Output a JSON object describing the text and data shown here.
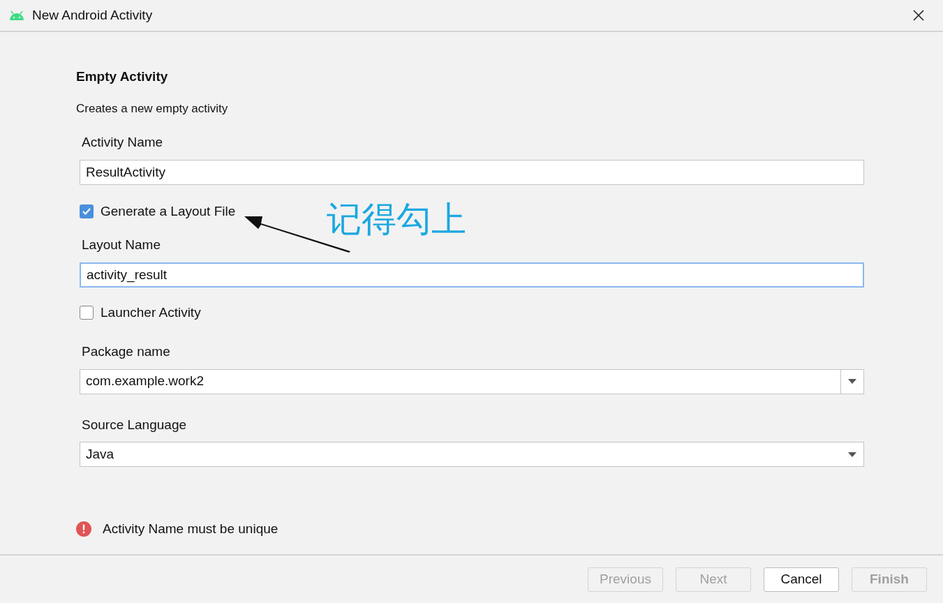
{
  "window": {
    "title": "New Android Activity"
  },
  "heading": "Empty Activity",
  "description": "Creates a new empty activity",
  "fields": [
    {
      "kind": "text",
      "label": "Activity Name",
      "value": "ResultActivity",
      "focused": false
    },
    {
      "kind": "checkbox",
      "label": "Generate a Layout File",
      "checked": true
    },
    {
      "kind": "text",
      "label": "Layout Name",
      "value": "activity_result",
      "focused": true
    },
    {
      "kind": "checkbox",
      "label": "Launcher Activity",
      "checked": false
    },
    {
      "kind": "combo",
      "label": "Package name",
      "value": "com.example.work2"
    },
    {
      "kind": "select",
      "label": "Source Language",
      "value": "Java"
    }
  ],
  "annotation": {
    "text": "记得勾上"
  },
  "error": "Activity Name must be unique",
  "buttons": [
    {
      "label": "Previous",
      "disabled": true,
      "default": false
    },
    {
      "label": "Next",
      "disabled": true,
      "default": false
    },
    {
      "label": "Cancel",
      "disabled": false,
      "default": false
    },
    {
      "label": "Finish",
      "disabled": true,
      "default": true
    }
  ]
}
